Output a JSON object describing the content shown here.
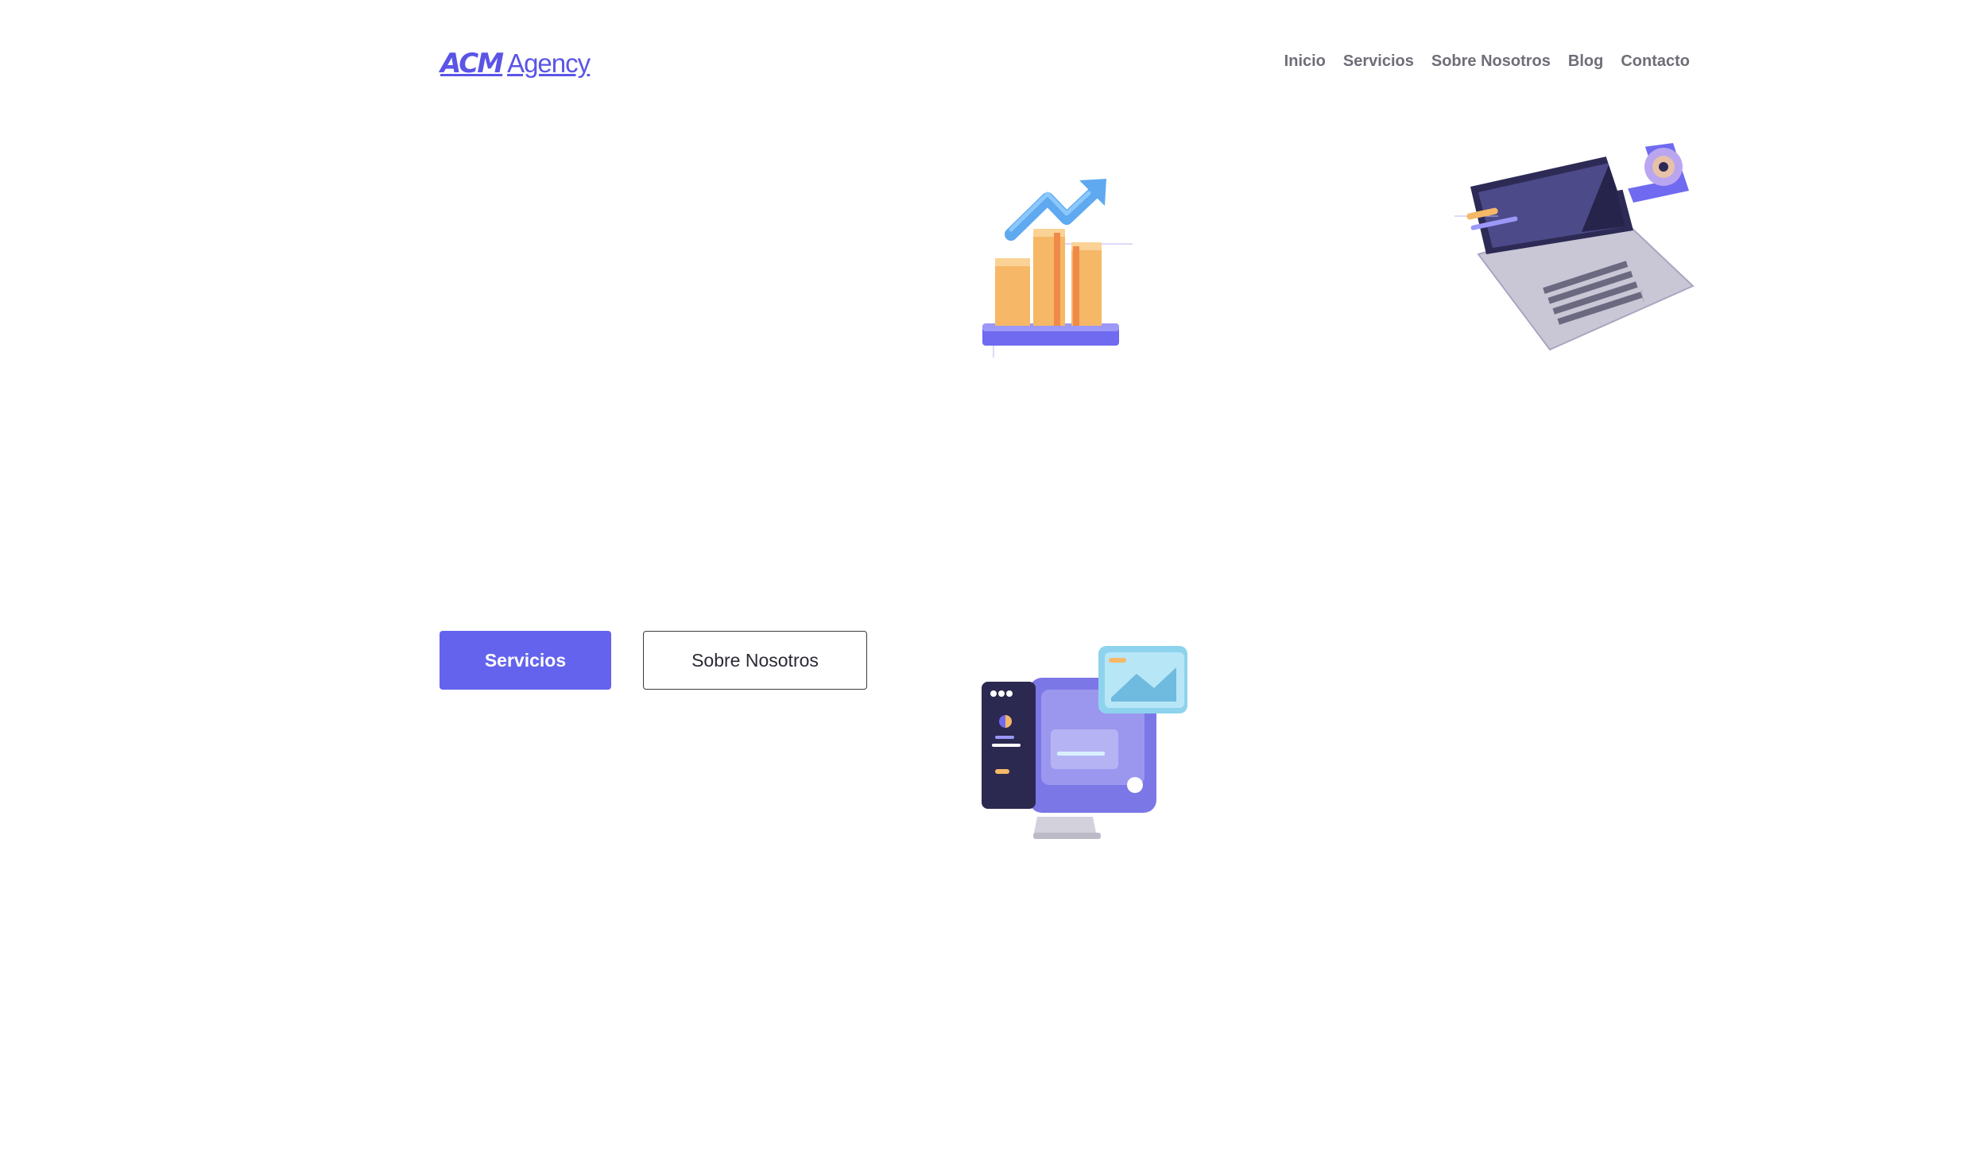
{
  "header": {
    "logo_mark": "ACM",
    "logo_word": "Agency",
    "nav": [
      {
        "label": "Inicio"
      },
      {
        "label": "Servicios"
      },
      {
        "label": "Sobre Nosotros"
      },
      {
        "label": "Blog"
      },
      {
        "label": "Contacto"
      }
    ]
  },
  "hero": {
    "primary_button": "Servicios",
    "secondary_button": "Sobre Nosotros"
  },
  "illustrations": {
    "chart": "growth-chart-illustration",
    "laptop": "laptop-illustration",
    "monitor": "monitor-illustration"
  },
  "colors": {
    "brand": "#5b55e6",
    "primary_button": "#6463ed",
    "nav_text": "#6e6e78"
  }
}
